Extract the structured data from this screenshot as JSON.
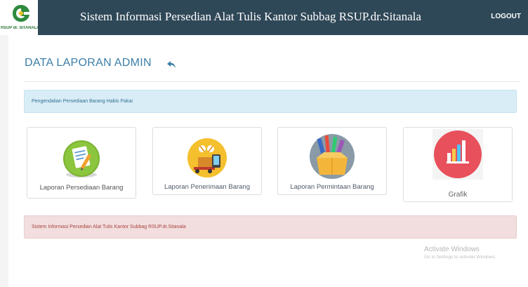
{
  "header": {
    "logo_text": "RSUP dr. SITANALA",
    "title": "Sistem Informasi Persedian Alat Tulis Kantor Subbag RSUP.dr.Sitanala",
    "logout_label": "LOGOUT"
  },
  "page": {
    "title": "DATA LAPORAN ADMIN",
    "back_icon": "reply-arrow-icon"
  },
  "info_alert": {
    "text": "Pengendalian Persediaan Barang Habis Pakai"
  },
  "cards": [
    {
      "label": "Laporan Persediaan Barang",
      "icon": "clipboard-report-icon"
    },
    {
      "label": "Laporan Penerimaan Barang",
      "icon": "delivery-receipt-icon"
    },
    {
      "label": "Laporan Permintaan Barang",
      "icon": "stationery-box-icon"
    },
    {
      "label": "Grafik",
      "icon": "bar-chart-icon"
    }
  ],
  "footer_alert": {
    "text": "Sistem Informasi Persedian Alat Tulis Kantor Subbag RSUP.dr.Sitanala"
  },
  "watermark": {
    "line1": "Activate Windows",
    "line2": "Go to Settings to activate Windows."
  },
  "colors": {
    "header_bg": "#2f4858",
    "title_blue": "#3b7fa8",
    "info_bg": "#d9edf7",
    "danger_bg": "#f2dede"
  }
}
